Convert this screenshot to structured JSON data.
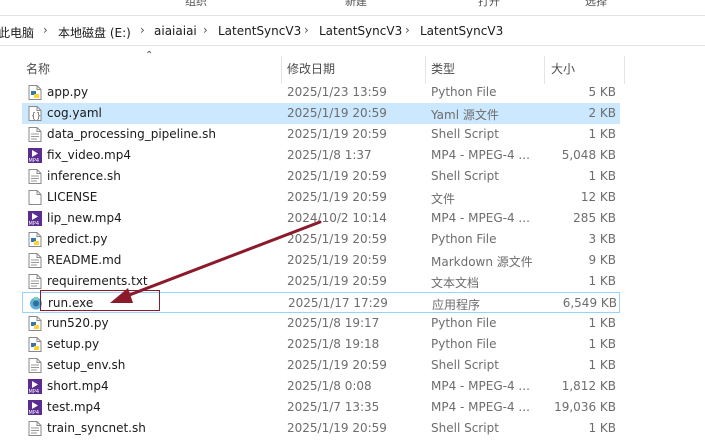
{
  "ribbon": {
    "items": [
      "组织",
      "新建",
      "打开",
      "选择"
    ]
  },
  "breadcrumb": {
    "items": [
      "此电脑",
      "本地磁盘 (E:)",
      "aiaiaiai",
      "LatentSyncV3",
      "LatentSyncV3",
      "LatentSyncV3"
    ],
    "separator": "›"
  },
  "columns": {
    "name": "名称",
    "date": "修改日期",
    "type": "类型",
    "size": "大小"
  },
  "files": [
    {
      "name": "app.py",
      "date": "2025/1/23 13:59",
      "type": "Python File",
      "size": "5 KB",
      "icon": "python-file-icon"
    },
    {
      "name": "cog.yaml",
      "date": "2025/1/19 20:59",
      "type": "Yaml 源文件",
      "size": "2 KB",
      "icon": "yaml-file-icon"
    },
    {
      "name": "data_processing_pipeline.sh",
      "date": "2025/1/19 20:59",
      "type": "Shell Script",
      "size": "1 KB",
      "icon": "shell-file-icon"
    },
    {
      "name": "fix_video.mp4",
      "date": "2025/1/8 1:37",
      "type": "MP4 - MPEG-4 ...",
      "size": "5,048 KB",
      "icon": "mp4-file-icon"
    },
    {
      "name": "inference.sh",
      "date": "2025/1/19 20:59",
      "type": "Shell Script",
      "size": "1 KB",
      "icon": "shell-file-icon"
    },
    {
      "name": "LICENSE",
      "date": "2025/1/19 20:59",
      "type": "文件",
      "size": "12 KB",
      "icon": "blank-file-icon"
    },
    {
      "name": "lip_new.mp4",
      "date": "2024/10/2 10:14",
      "type": "MP4 - MPEG-4 ...",
      "size": "285 KB",
      "icon": "mp4-file-icon"
    },
    {
      "name": "predict.py",
      "date": "2025/1/19 20:59",
      "type": "Python File",
      "size": "3 KB",
      "icon": "python-file-icon"
    },
    {
      "name": "README.md",
      "date": "2025/1/19 20:59",
      "type": "Markdown 源文件",
      "size": "9 KB",
      "icon": "markdown-file-icon"
    },
    {
      "name": "requirements.txt",
      "date": "2025/1/19 20:59",
      "type": "文本文档",
      "size": "1 KB",
      "icon": "text-file-icon"
    },
    {
      "name": "run.exe",
      "date": "2025/1/17 17:29",
      "type": "应用程序",
      "size": "6,549 KB",
      "icon": "exe-file-icon"
    },
    {
      "name": "run520.py",
      "date": "2025/1/8 19:17",
      "type": "Python File",
      "size": "1 KB",
      "icon": "python-file-icon"
    },
    {
      "name": "setup.py",
      "date": "2025/1/8 19:18",
      "type": "Python File",
      "size": "1 KB",
      "icon": "python-file-icon"
    },
    {
      "name": "setup_env.sh",
      "date": "2025/1/19 20:59",
      "type": "Shell Script",
      "size": "1 KB",
      "icon": "shell-file-icon"
    },
    {
      "name": "short.mp4",
      "date": "2025/1/8 0:08",
      "type": "MP4 - MPEG-4 ...",
      "size": "1,812 KB",
      "icon": "mp4-file-icon"
    },
    {
      "name": "test.mp4",
      "date": "2025/1/7 13:35",
      "type": "MP4 - MPEG-4 ...",
      "size": "19,036 KB",
      "icon": "mp4-file-icon"
    },
    {
      "name": "train_syncnet.sh",
      "date": "2025/1/19 20:59",
      "type": "Shell Script",
      "size": "1 KB",
      "icon": "shell-file-icon"
    }
  ],
  "selected_row": 1,
  "focused_row": 10,
  "icon_labels": {
    "mp4": "MP4"
  },
  "colors": {
    "selection": "#cce8ff",
    "annotation": "#8b1a2b",
    "python_blue": "#3776ab",
    "python_yellow": "#ffd43b",
    "mp4_purple": "#5b2d90"
  }
}
